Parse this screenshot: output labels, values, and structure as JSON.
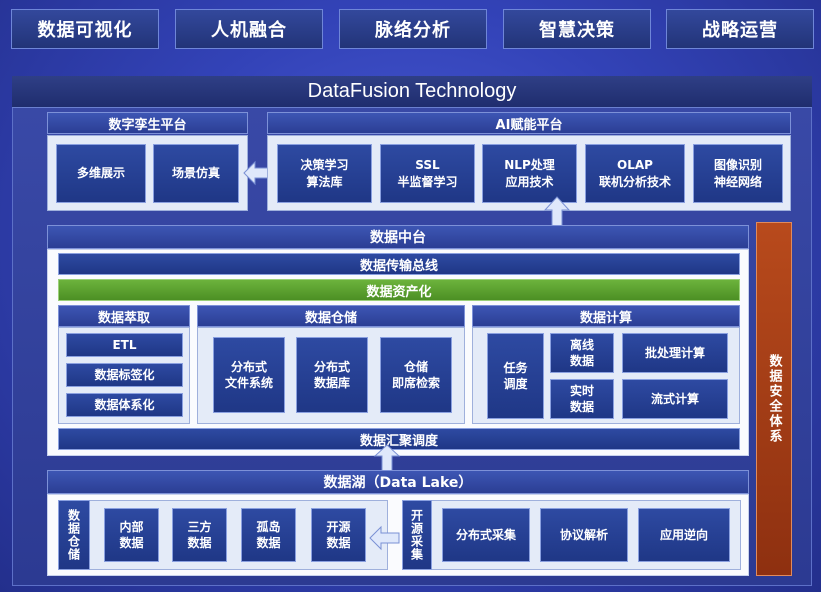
{
  "nav": {
    "items": [
      "数据可视化",
      "人机融合",
      "脉络分析",
      "智慧决策",
      "战略运营"
    ]
  },
  "title": "DataFusion Technology",
  "twin_platform": {
    "title": "数字孪生平台",
    "items": [
      "多维展示",
      "场景仿真"
    ]
  },
  "ai_platform": {
    "title": "AI赋能平台",
    "items": [
      {
        "line1": "决策学习",
        "line2": "算法库"
      },
      {
        "line1": "SSL",
        "line2": "半监督学习"
      },
      {
        "line1": "NLP处理",
        "line2": "应用技术"
      },
      {
        "line1": "OLAP",
        "line2": "联机分析技术"
      },
      {
        "line1": "图像识别",
        "line2": "神经网络"
      }
    ]
  },
  "data_middle": {
    "title": "数据中台",
    "bus": "数据传输总线",
    "assets": "数据资产化",
    "extract": {
      "title": "数据萃取",
      "items": [
        "ETL",
        "数据标签化",
        "数据体系化"
      ]
    },
    "warehouse": {
      "title": "数据仓储",
      "items": [
        {
          "line1": "分布式",
          "line2": "文件系统"
        },
        {
          "line1": "分布式",
          "line2": "数据库"
        },
        {
          "line1": "仓储",
          "line2": "即席检索"
        }
      ]
    },
    "compute": {
      "title": "数据计算",
      "schedule": {
        "line1": "任务",
        "line2": "调度"
      },
      "offline": {
        "line1": "离线",
        "line2": "数据"
      },
      "realtime": {
        "line1": "实时",
        "line2": "数据"
      },
      "batch": "批处理计算",
      "stream": "流式计算"
    },
    "aggregate": "数据汇聚调度"
  },
  "security": "数据安全体系",
  "data_lake": {
    "title": "数据湖（Data Lake）",
    "warehouse_label": "数据仓储",
    "items": [
      {
        "line1": "内部",
        "line2": "数据"
      },
      {
        "line1": "三方",
        "line2": "数据"
      },
      {
        "line1": "孤岛",
        "line2": "数据"
      },
      {
        "line1": "开源",
        "line2": "数据"
      }
    ],
    "open_source_label": "开源采集",
    "collect": [
      "分布式采集",
      "协议解析",
      "应用逆向"
    ]
  },
  "colors": {
    "background": "#3343b8",
    "box_blue": "#2e4aa2",
    "assets_green": "#5ea232",
    "security_orange": "#a33f16",
    "panel_light": "#e4ebf8"
  }
}
